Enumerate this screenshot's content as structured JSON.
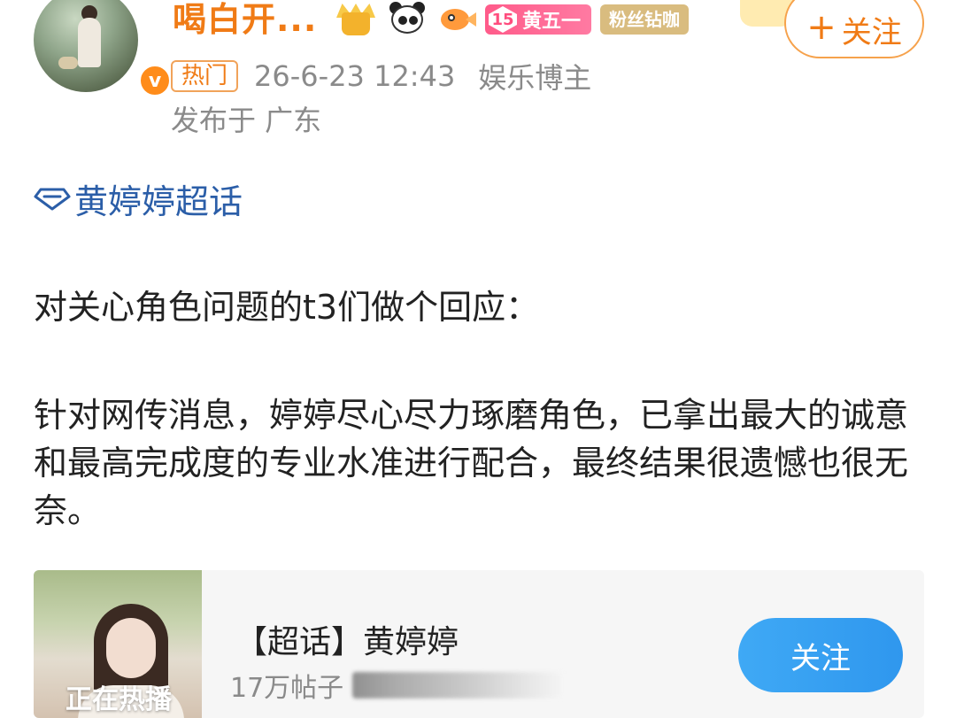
{
  "header": {
    "username": "喝白开...",
    "fan_level": "15",
    "fan_level_name": "黄五一",
    "fan_tag": "粉丝钻咖",
    "follow_label": "关注",
    "follow_plus": "+",
    "hot_tag": "热门",
    "timestamp": "26-6-23 12:43",
    "role": "娱乐博主",
    "location": "发布于 广东",
    "verified": "v"
  },
  "post": {
    "topic": "黄婷婷超话",
    "paragraph1": "对关心角色问题的t3们做个回应：",
    "paragraph2": "针对网传消息，婷婷尽心尽力琢磨角色，已拿出最大的诚意和最高完成度的专业水准进行配合，最终结果很遗憾也很无奈。"
  },
  "card": {
    "title": "【超话】黄婷婷",
    "posts_count": "17万帖子",
    "thumb_caption": "正在热播",
    "follow_label": "关注"
  },
  "colors": {
    "username": "#f07b16",
    "topic_link": "#2b5ea8",
    "card_follow": "#2f97ee"
  },
  "icons": [
    "vip-crown-icon",
    "panda-icon",
    "fish-icon",
    "fan-level-diamond-icon",
    "super-topic-diamond-icon",
    "verified-icon"
  ]
}
